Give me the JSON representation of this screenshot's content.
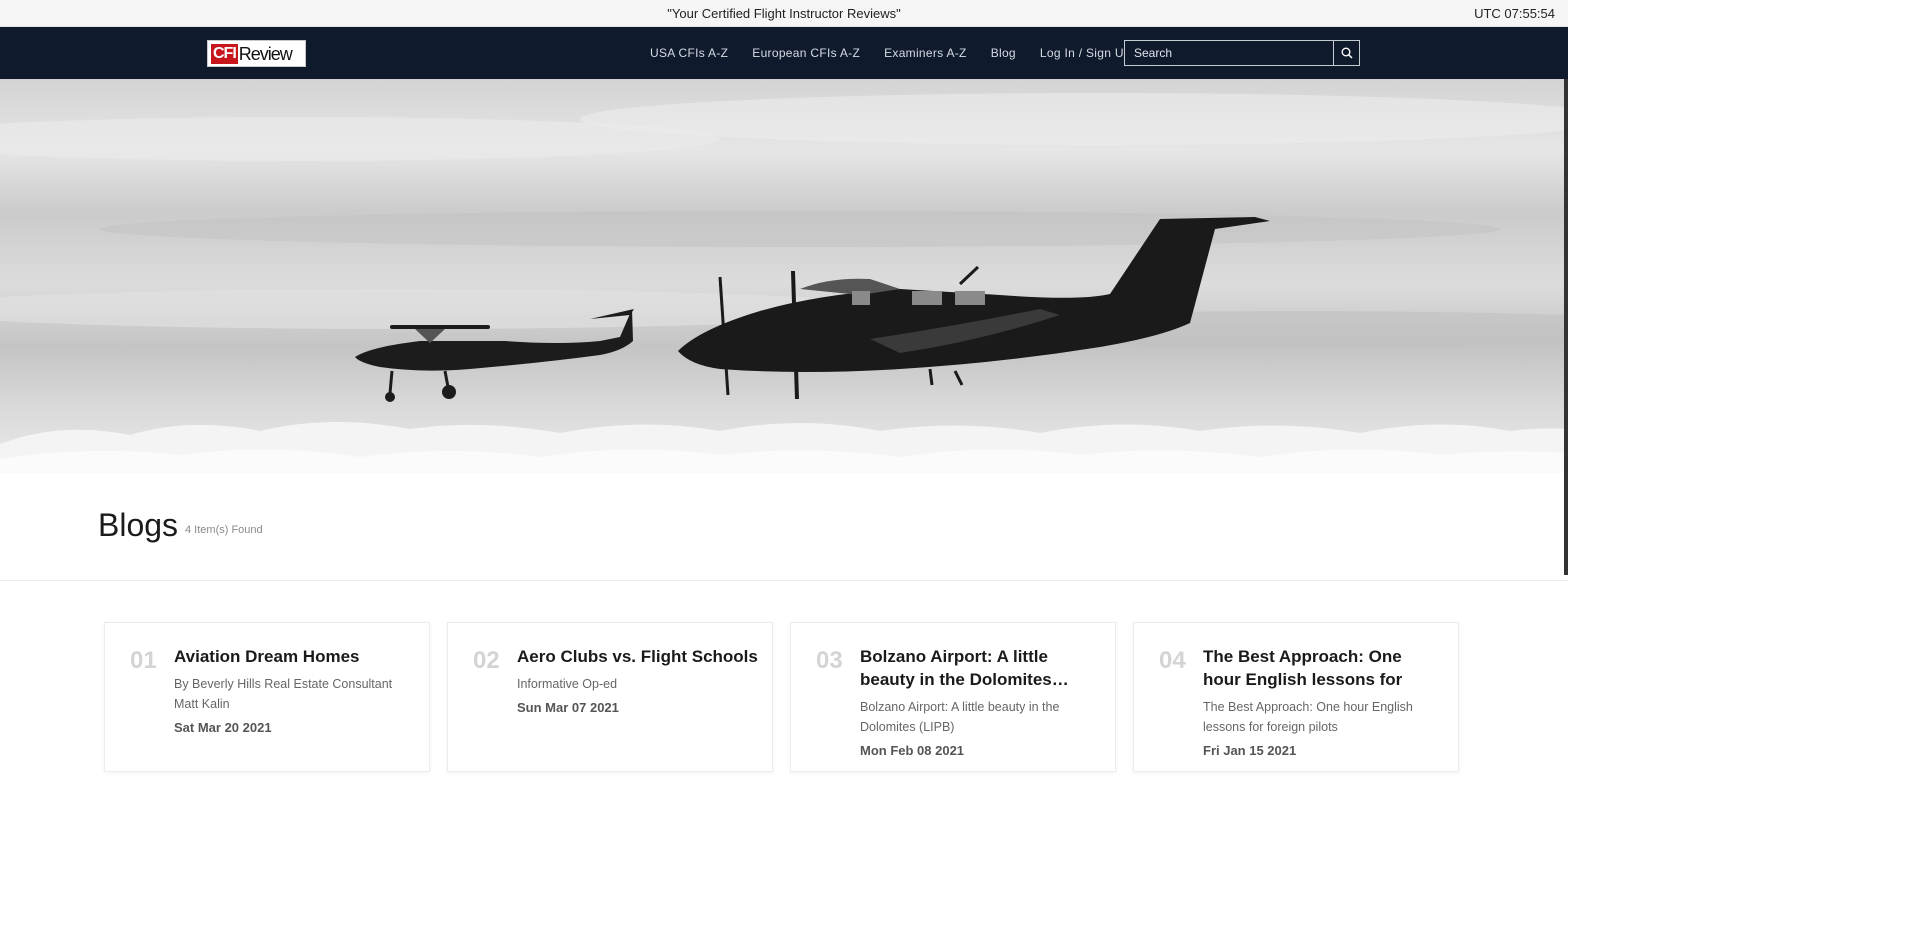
{
  "topbar": {
    "tagline": "\"Your Certified Flight Instructor Reviews\"",
    "clock": "UTC 07:55:54"
  },
  "navbar": {
    "logo": {
      "part1": "CFI",
      "part2": "Review"
    },
    "links": [
      "USA CFIs A-Z",
      "European CFIs A-Z",
      "Examiners A-Z",
      "Blog",
      "Log In / Sign Up"
    ],
    "search_placeholder": "Search",
    "search_icon": "search-icon",
    "background": "#0f1a2c"
  },
  "hero": {
    "image": "two-airplanes-flying-above-clouds-grayscale"
  },
  "blogs": {
    "title": "Blogs",
    "count": "4 Item(s) Found",
    "items": [
      {
        "num": "01",
        "title": "Aviation Dream Homes",
        "desc": "By Beverly Hills Real Estate Consultant Matt Kalin",
        "date": "Sat Mar 20 2021"
      },
      {
        "num": "02",
        "title": "Aero Clubs vs. Flight Schools",
        "desc": "Informative Op-ed",
        "date": "Sun Mar 07 2021"
      },
      {
        "num": "03",
        "title": "Bolzano Airport: A little beauty in the Dolomites…",
        "desc": "Bolzano Airport: A little beauty in the Dolomites (LIPB)",
        "date": "Mon Feb 08 2021"
      },
      {
        "num": "04",
        "title": "The Best Approach: One hour English lessons for foreign…",
        "desc": "The Best Approach: One hour English lessons for foreign pilots",
        "date": "Fri Jan 15 2021"
      }
    ]
  }
}
